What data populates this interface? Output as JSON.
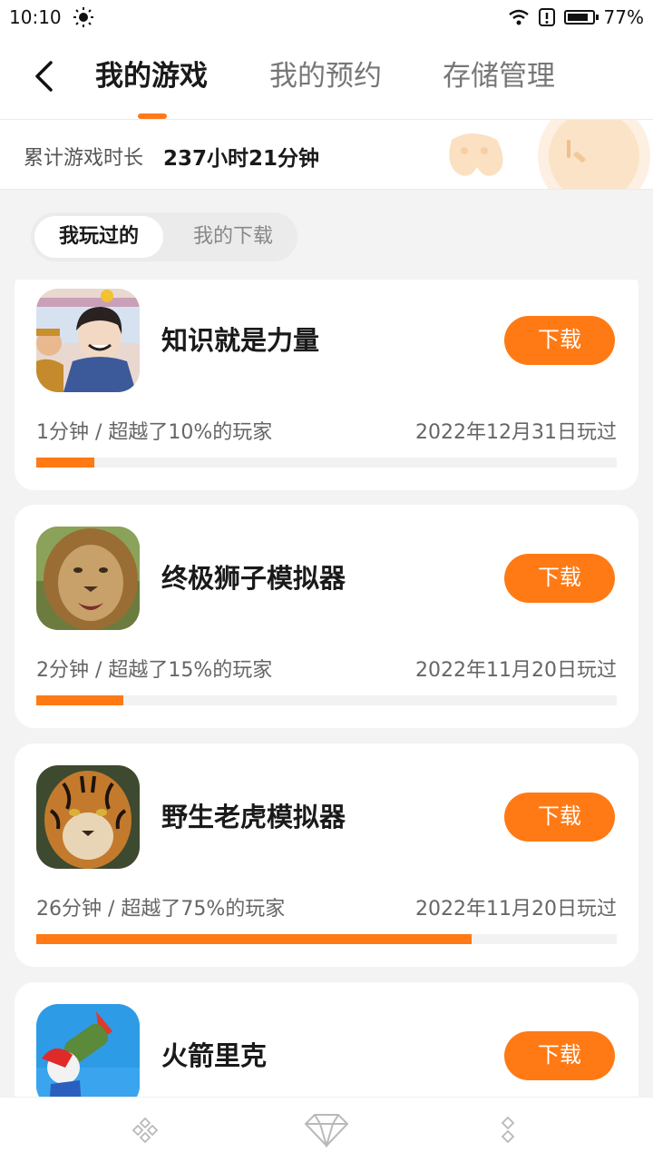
{
  "status_bar": {
    "time": "10:10",
    "battery": "77%"
  },
  "header": {
    "tabs": [
      {
        "label": "我的游戏",
        "active": true
      },
      {
        "label": "我的预约",
        "active": false
      },
      {
        "label": "存储管理",
        "active": false
      }
    ]
  },
  "summary": {
    "label": "累计游戏时长",
    "value": "237小时21分钟"
  },
  "sub_tabs": [
    {
      "label": "我玩过的",
      "active": true
    },
    {
      "label": "我的下载",
      "active": false
    }
  ],
  "games": [
    {
      "name": "知识就是力量",
      "stats": "1分钟 / 超越了10%的玩家",
      "date": "2022年12月31日玩过",
      "progress": 0.1,
      "button": "下载",
      "icon": "quiz-game-icon"
    },
    {
      "name": "终极狮子模拟器",
      "stats": "2分钟 / 超越了15%的玩家",
      "date": "2022年11月20日玩过",
      "progress": 0.15,
      "button": "下载",
      "icon": "lion-game-icon"
    },
    {
      "name": "野生老虎模拟器",
      "stats": "26分钟 / 超越了75%的玩家",
      "date": "2022年11月20日玩过",
      "progress": 0.75,
      "button": "下载",
      "icon": "tiger-game-icon"
    },
    {
      "name": "火箭里克",
      "stats": "",
      "date": "",
      "progress": null,
      "button": "下载",
      "icon": "rocket-game-icon"
    }
  ],
  "colors": {
    "accent": "#ff7a14",
    "background": "#f3f3f3"
  },
  "bottom_nav": [
    {
      "icon": "diamond-cluster-icon"
    },
    {
      "icon": "gem-icon"
    },
    {
      "icon": "diamond-pair-icon"
    }
  ]
}
